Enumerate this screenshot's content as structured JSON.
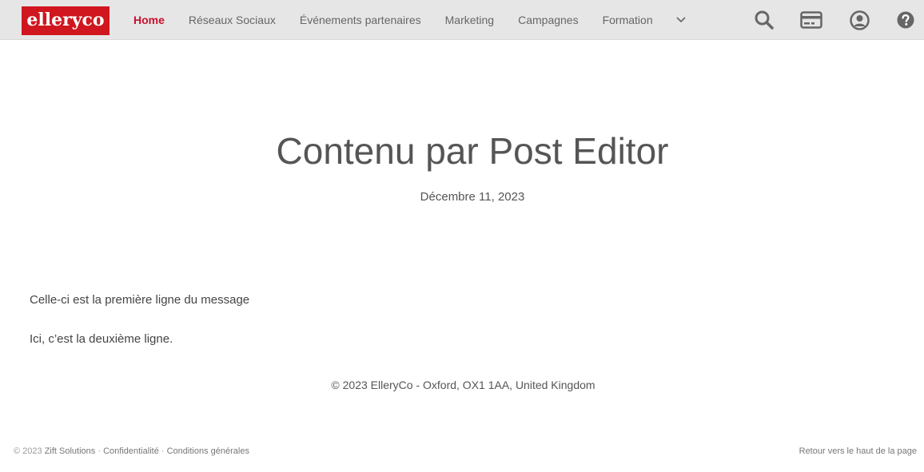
{
  "brand": {
    "logo_text": "elleryco",
    "logo_color": "#d0161e"
  },
  "nav": {
    "items": [
      {
        "label": "Home",
        "active": true
      },
      {
        "label": "Réseaux Sociaux",
        "active": false
      },
      {
        "label": "Événements partenaires",
        "active": false
      },
      {
        "label": "Marketing",
        "active": false
      },
      {
        "label": "Campagnes",
        "active": false
      },
      {
        "label": "Formation",
        "active": false
      }
    ],
    "more_icon": "chevron-down-icon",
    "active_color": "#c8102e",
    "icons": [
      "search-icon",
      "credit-card-icon",
      "user-account-icon",
      "help-icon"
    ]
  },
  "post": {
    "title": "Contenu par Post Editor",
    "date": "Décembre 11, 2023",
    "lines": [
      "Celle-ci est la première ligne du message",
      "Ici, c’est la deuxième ligne."
    ]
  },
  "site_footer": {
    "copyright": "© 2023 ElleryCo - Oxford, OX1 1AA, United Kingdom"
  },
  "page_footer": {
    "year": "© 2023",
    "company": "Zift Solutions",
    "sep": "·",
    "privacy": "Confidentialité",
    "terms": "Conditions générales",
    "back_to_top": "Retour vers le haut de la page"
  }
}
